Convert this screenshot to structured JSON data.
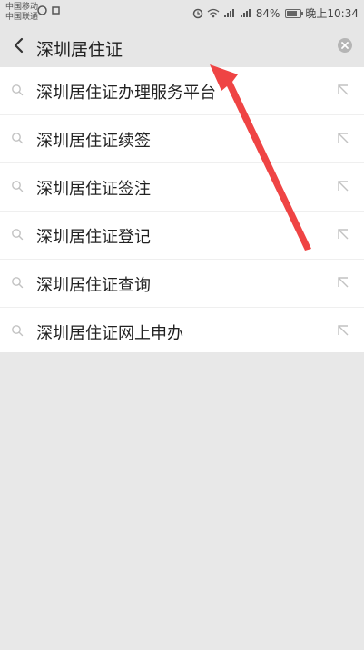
{
  "status_bar": {
    "carrier_1": "中国移动",
    "carrier_2": "中国联通",
    "battery_percent": "84%",
    "time": "晚上10:34"
  },
  "search": {
    "query": "深圳居住证"
  },
  "suggestions": [
    {
      "text": "深圳居住证办理服务平台"
    },
    {
      "text": "深圳居住证续签"
    },
    {
      "text": "深圳居住证签注"
    },
    {
      "text": "深圳居住证登记"
    },
    {
      "text": "深圳居住证查询"
    },
    {
      "text": "深圳居住证网上申办"
    }
  ],
  "icons": {
    "back": "back-arrow-icon",
    "clear": "clear-icon",
    "suggestion": "search-icon",
    "fill": "arrow-up-left-icon"
  },
  "colors": {
    "annotation_arrow": "#ef4444",
    "header_background": "#e6e6e6",
    "list_background": "#ffffff"
  }
}
